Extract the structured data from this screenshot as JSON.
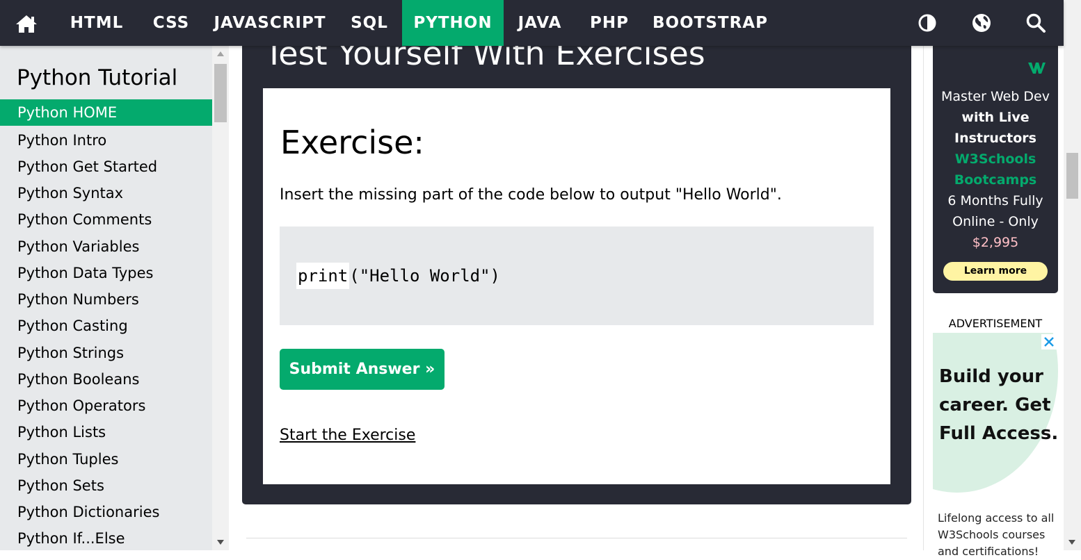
{
  "nav": {
    "links": [
      "HTML",
      "CSS",
      "JAVASCRIPT",
      "SQL",
      "PYTHON",
      "JAVA",
      "PHP",
      "BOOTSTRAP"
    ],
    "active": "PYTHON",
    "icons": [
      "home-icon",
      "contrast-icon",
      "globe-icon",
      "search-icon"
    ]
  },
  "sidebar": {
    "title": "Python Tutorial",
    "items": [
      "Python HOME",
      "Python Intro",
      "Python Get Started",
      "Python Syntax",
      "Python Comments",
      "Python Variables",
      "Python Data Types",
      "Python Numbers",
      "Python Casting",
      "Python Strings",
      "Python Booleans",
      "Python Operators",
      "Python Lists",
      "Python Tuples",
      "Python Sets",
      "Python Dictionaries",
      "Python If...Else"
    ],
    "active": "Python HOME"
  },
  "exercise": {
    "section_title": "Test Yourself With Exercises",
    "heading": "Exercise:",
    "description": "Insert the missing part of the code below to output \"Hello World\".",
    "code_input": "print",
    "code_rest": "(\"Hello World\")",
    "submit_label": "Submit Answer »",
    "start_link": "Start the Exercise"
  },
  "ad1": {
    "lines": [
      "Master Web Dev",
      "with Live",
      "Instructors",
      "W3Schools",
      "Bootcamps",
      "6 Months Fully",
      "Online - Only",
      "$2,995"
    ],
    "button": "Learn more"
  },
  "ad2": {
    "label": "ADVERTISEMENT",
    "headline": [
      "Build your",
      "career. Get",
      "Full Access."
    ],
    "sub": [
      "Lifelong access to all",
      "W3Schools courses",
      "and certifications!"
    ]
  },
  "colors": {
    "accent": "#04aa6d",
    "nav_bg": "#282a35",
    "sidebar_bg": "#e7e9eb",
    "button_yellow": "#fff4a3"
  }
}
